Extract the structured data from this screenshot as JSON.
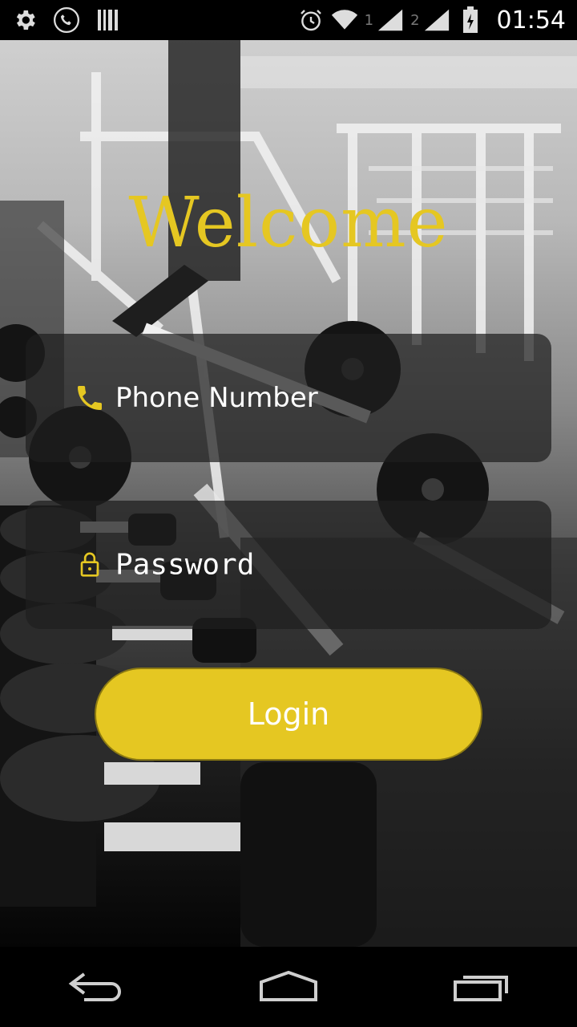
{
  "status_bar": {
    "time": "01:54",
    "sim1": "1",
    "sim2": "2",
    "icons": [
      "settings-icon",
      "phone-icon",
      "barcode-icon",
      "alarm-icon",
      "wifi-icon",
      "signal-icon",
      "battery-icon"
    ]
  },
  "screen": {
    "title": "Welcome",
    "phone_placeholder": "Phone Number",
    "password_placeholder": "Password",
    "login_label": "Login"
  },
  "nav_bar": {
    "icons": [
      "back-icon",
      "home-icon",
      "recents-icon"
    ]
  },
  "colors": {
    "accent": "#e5c722",
    "field_bg": "#1e1e1e",
    "text": "#ffffff"
  }
}
